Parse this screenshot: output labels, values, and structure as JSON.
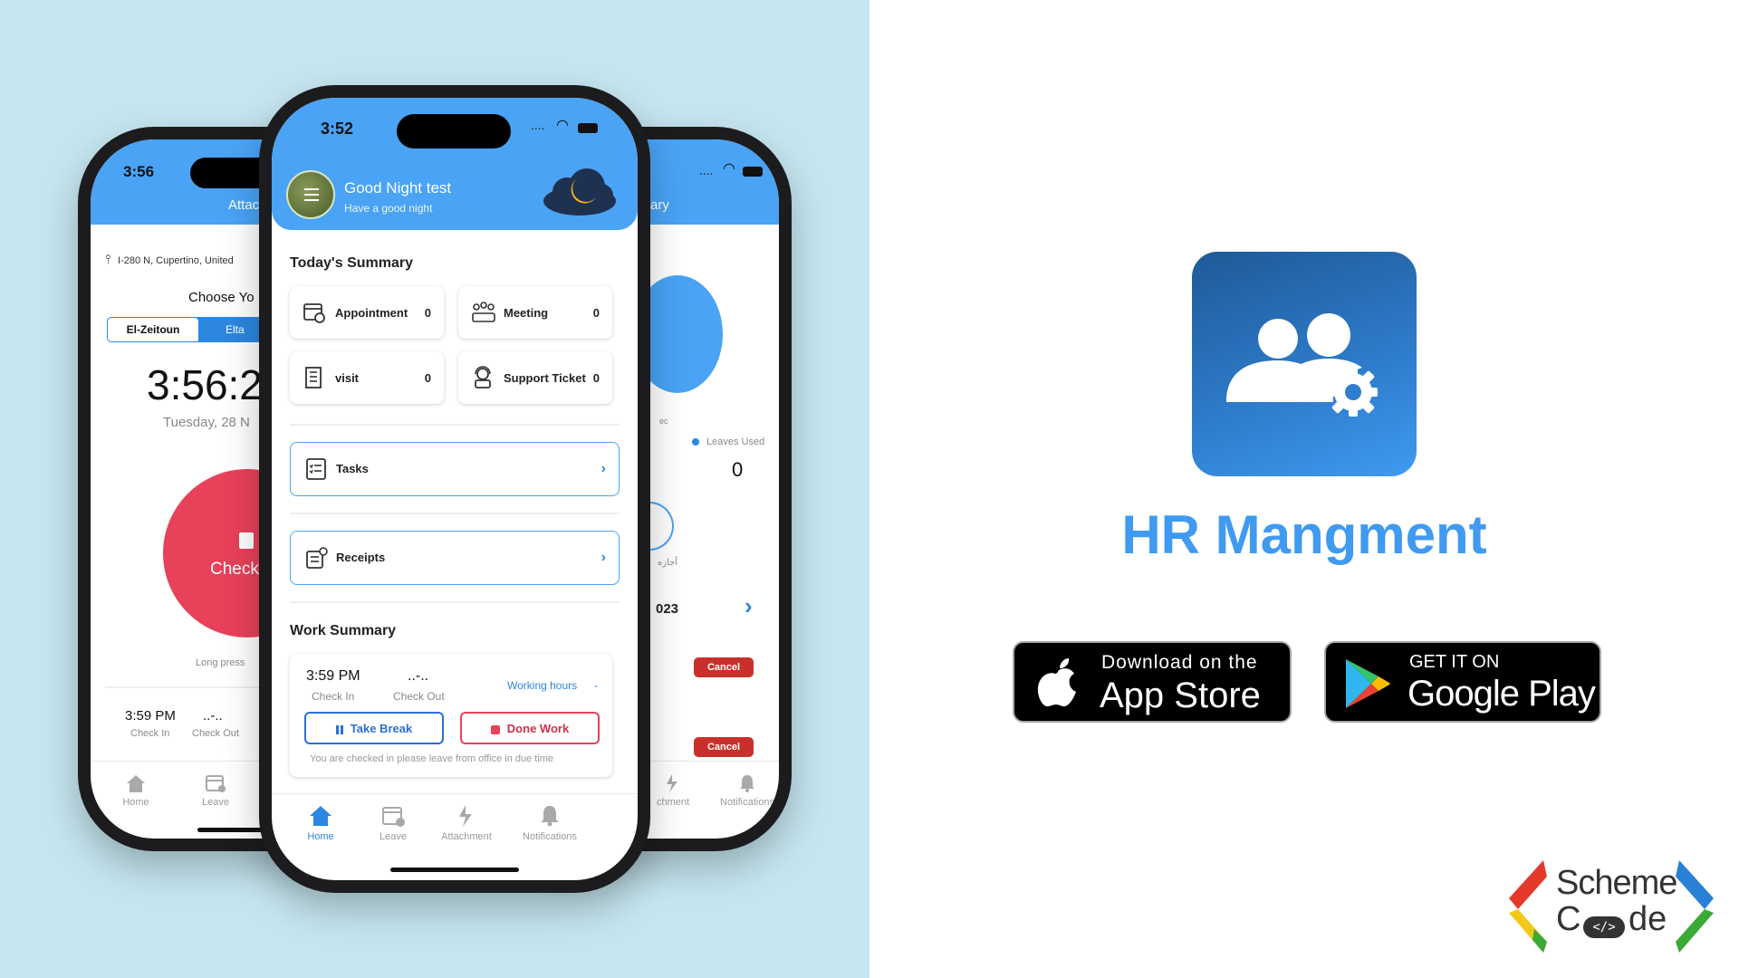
{
  "colors": {
    "left_bg": "#c5e5ef",
    "app_blue": "#4aa3f5",
    "app_icon_top": "#1e5a96",
    "app_icon_bottom": "#3f9af0",
    "red": "#e8415a",
    "cancel_red": "#c9302c"
  },
  "back_left_phone": {
    "time": "3:56",
    "header_title": "Attach",
    "location": "I-280 N, Cupertino, United",
    "choose_label": "Choose Yo",
    "branch_selected": "El-Zeitoun",
    "branch_other": "Elta",
    "clock": "3:56:2",
    "date": "Tuesday, 28 N",
    "check_button": "Check",
    "long_press_hint": "Long press",
    "check_in_time": "3:59 PM",
    "check_in_label": "Check In",
    "check_out_time": "..-..",
    "check_out_label": "Check Out",
    "nav": [
      "Home",
      "Leave"
    ]
  },
  "back_right_phone": {
    "header_title": "ary",
    "legend": "Leaves Used",
    "leaves_used": "0",
    "arabic_label": "أجازه",
    "year_label": "023",
    "cancel_1": "Cancel",
    "cancel_2": "Cancel",
    "nav": [
      "chment",
      "Notifications"
    ],
    "side_mark": "ec"
  },
  "front_phone": {
    "time": "3:52",
    "greeting": "Good Night test",
    "greeting_sub": "Have a good night",
    "summary_title": "Today's Summary",
    "summary": [
      {
        "label": "Appointment",
        "count": "0",
        "icon": "calendar-clock-icon"
      },
      {
        "label": "Meeting",
        "count": "0",
        "icon": "people-meeting-icon"
      },
      {
        "label": "visit",
        "count": "0",
        "icon": "building-icon"
      },
      {
        "label": "Support Ticket",
        "count": "0",
        "icon": "support-ticket-icon"
      }
    ],
    "tasks_label": "Tasks",
    "receipts_label": "Receipts",
    "work_summary_title": "Work Summary",
    "check_in_time": "3:59 PM",
    "check_in_label": "Check In",
    "check_out_time": "..-..",
    "check_out_label": "Check Out",
    "working_hours": "Working hours",
    "working_hours_value": "-",
    "take_break": "Take Break",
    "done_work": "Done Work",
    "notice": "You are checked in please leave from office in due time",
    "nav": [
      {
        "label": "Home",
        "icon": "home-icon"
      },
      {
        "label": "Leave",
        "icon": "calendar-icon"
      },
      {
        "label": "Attachment",
        "icon": "attachment-icon"
      },
      {
        "label": "Notifications",
        "icon": "bell-icon"
      }
    ]
  },
  "promo": {
    "app_name": "HR Mangment",
    "app_store_line1": "Download on the",
    "app_store_line2": "App Store",
    "google_line1": "GET IT ON",
    "google_line2": "Google Play",
    "brand_line1": "Scheme",
    "brand_line2a": "C",
    "brand_line2b": "de",
    "brand_code_glyph": "</>"
  }
}
